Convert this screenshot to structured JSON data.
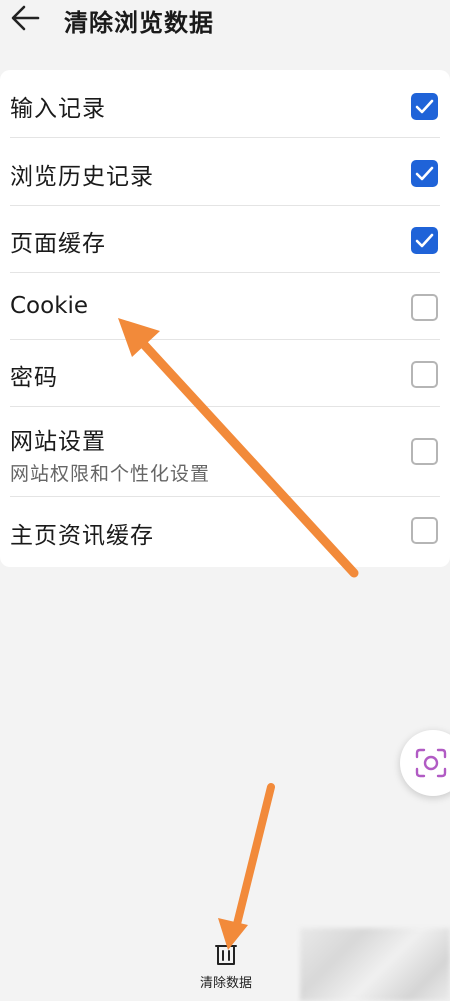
{
  "header": {
    "title": "清除浏览数据",
    "back_icon": "arrow-left-icon"
  },
  "items": [
    {
      "label": "输入记录",
      "checked": true
    },
    {
      "label": "浏览历史记录",
      "checked": true
    },
    {
      "label": "页面缓存",
      "checked": true
    },
    {
      "label": "Cookie",
      "checked": false
    },
    {
      "label": "密码",
      "checked": false
    },
    {
      "label": "网站设置",
      "sublabel": "网站权限和个性化设置",
      "checked": false
    },
    {
      "label": "主页资讯缓存",
      "checked": false
    }
  ],
  "floating_button": {
    "icon": "screenshot-scan-icon"
  },
  "bottom_bar": {
    "clear_label": "清除数据",
    "clear_icon": "trash-icon"
  },
  "colors": {
    "accent": "#1f63d8",
    "annotation_arrow": "#f28a3a",
    "background": "#f3f3f3"
  }
}
